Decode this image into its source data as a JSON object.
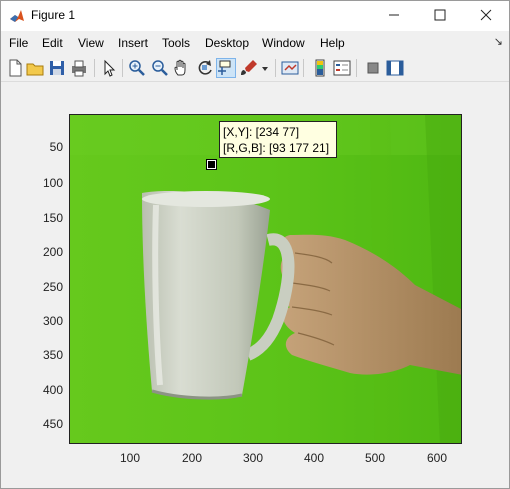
{
  "window": {
    "title": "Figure 1"
  },
  "menu": {
    "items": [
      "File",
      "Edit",
      "View",
      "Insert",
      "Tools",
      "Desktop",
      "Window",
      "Help"
    ]
  },
  "toolbar": {
    "buttons": [
      "new-figure",
      "open-file",
      "save",
      "print",
      "edit-plot",
      "zoom-in",
      "zoom-out",
      "pan",
      "rotate-3d",
      "data-cursor",
      "brush",
      "link-plot",
      "insert-colorbar",
      "insert-legend",
      "hide-plot-tools",
      "show-plot-tools"
    ],
    "active": "data-cursor"
  },
  "axes": {
    "y_ticks": [
      "50",
      "100",
      "150",
      "200",
      "250",
      "300",
      "350",
      "400",
      "450"
    ],
    "x_ticks": [
      "100",
      "200",
      "300",
      "400",
      "500",
      "600"
    ]
  },
  "datatip": {
    "line1": "[X,Y]: [234 77]",
    "line2": "[R,G,B]: [93 177 21]"
  },
  "colors": {
    "background_green": "#5fc619",
    "tooltip_bg": "#ffffe1"
  }
}
